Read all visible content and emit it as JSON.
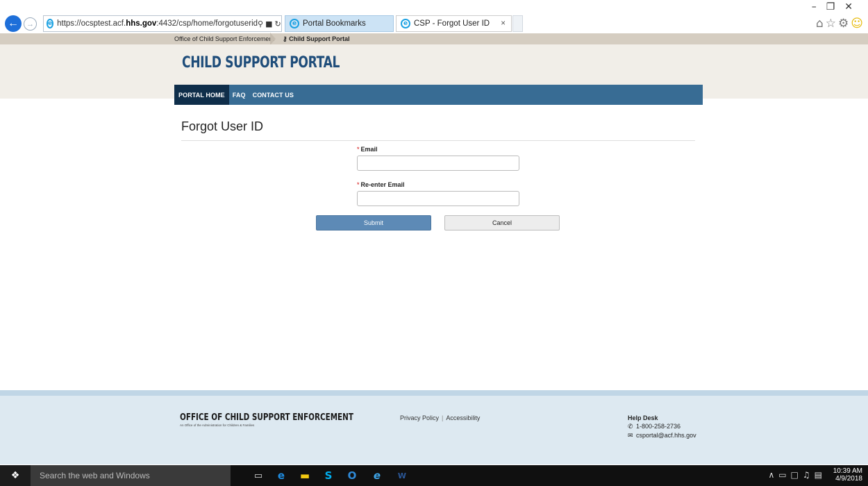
{
  "browser": {
    "url_prefix": "https://ocsptest.acf.",
    "url_host": "hhs.gov",
    "url_rest": ":4432/csp/home/forgotuserid",
    "tabs": [
      {
        "label": "Portal Bookmarks"
      },
      {
        "label": "CSP - Forgot User ID",
        "close": "×"
      }
    ]
  },
  "breadcrumb": {
    "parent": "Office of Child Support Enforcement",
    "current": "Child Support Portal"
  },
  "header": {
    "logo": "CHILD SUPPORT PORTAL",
    "nav": [
      "PORTAL HOME",
      "FAQ",
      "CONTACT US"
    ]
  },
  "form": {
    "title": "Forgot User ID",
    "required_mark": "*",
    "email_label": "Email",
    "reenter_label": "Re-enter Email",
    "email_value": "",
    "reenter_value": "",
    "submit": "Submit",
    "cancel": "Cancel"
  },
  "footer": {
    "org": "OFFICE OF CHILD SUPPORT ENFORCEMENT",
    "org_sub": "An Office of the Administration for Children & Families",
    "privacy": "Privacy Policy",
    "accessibility": "Accessibility",
    "help_title": "Help Desk",
    "phone": "1-800-258-2736",
    "email": "csportal@acf.hhs.gov"
  },
  "taskbar": {
    "search_placeholder": "Search the web and Windows",
    "time": "10:39 AM",
    "date": "4/9/2018"
  },
  "icons": [
    "back-icon",
    "forward-icon",
    "ie-icon",
    "search-icon",
    "lock-icon",
    "refresh-icon",
    "home-icon",
    "star-icon",
    "gear-icon",
    "smiley-icon",
    "windows-icon",
    "task-view-icon",
    "edge-icon",
    "file-explorer-icon",
    "skype-icon",
    "outlook-icon",
    "word-icon",
    "phone-icon",
    "mail-icon"
  ]
}
